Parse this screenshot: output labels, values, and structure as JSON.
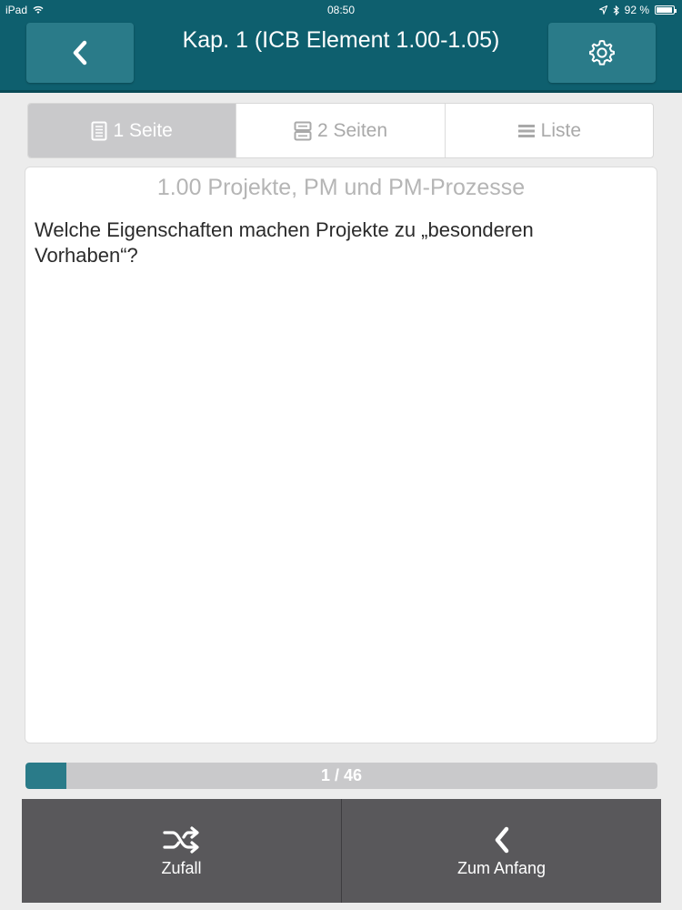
{
  "status_bar": {
    "device": "iPad",
    "time": "08:50",
    "battery": "92 %",
    "battery_level": 0.92
  },
  "header": {
    "title": "Kap. 1 (ICB Element 1.00-1.05)",
    "back_icon": "chevron-left-icon",
    "settings_icon": "gear-icon"
  },
  "view_modes": [
    {
      "label": "1 Seite",
      "icon": "single-page-icon",
      "active": true
    },
    {
      "label": "2 Seiten",
      "icon": "two-pages-icon",
      "active": false
    },
    {
      "label": "Liste",
      "icon": "list-icon",
      "active": false
    }
  ],
  "card": {
    "title": "1.00 Projekte, PM und PM-Prozesse",
    "question": "Welche Eigenschaften machen Projekte zu „besonderen Vorhaben“?"
  },
  "progress": {
    "label": "1 / 46",
    "current": 1,
    "total": 46,
    "fraction": 0.065
  },
  "bottom_buttons": {
    "random_label": "Zufall",
    "random_icon": "shuffle-icon",
    "start_label": "Zum Anfang",
    "start_icon": "chevron-left-icon"
  },
  "colors": {
    "header": "#0e5f6e",
    "accent": "#2a7b89",
    "bottom_bar": "#59585b"
  }
}
